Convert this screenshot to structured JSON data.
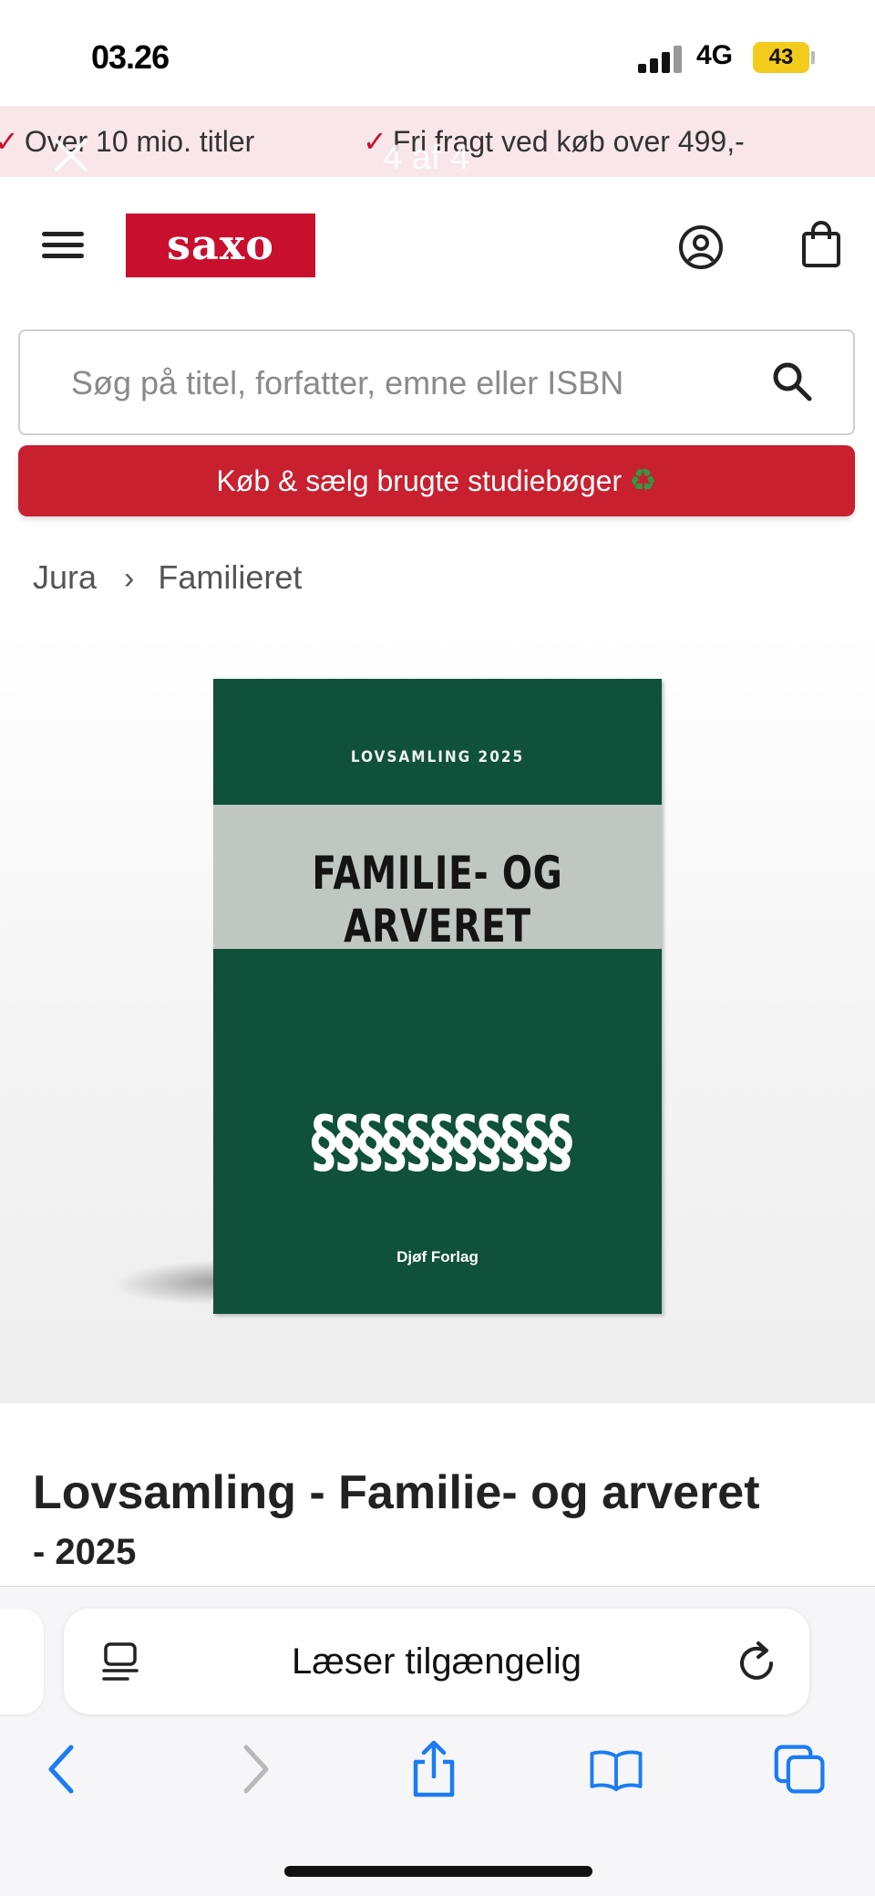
{
  "status_bar": {
    "time": "03.26",
    "network": "4G",
    "battery": "43"
  },
  "overlay": {
    "counter": "4 af 4"
  },
  "usp_bar": {
    "items": [
      "Over 10 mio. titler",
      "Fri fragt ved køb over 499,-"
    ]
  },
  "header": {
    "logo": "saxo"
  },
  "search": {
    "placeholder": "Søg på titel, forfatter, emne eller ISBN"
  },
  "cta": {
    "label": "Køb & sælg brugte studiebøger",
    "icon": "♻"
  },
  "breadcrumb": {
    "items": [
      "Jura",
      "Familieret"
    ],
    "separator": "›"
  },
  "book_cover": {
    "series": "LOVSAMLING 2025",
    "title": "FAMILIE- OG ARVERET",
    "paragraphs": "§§§§§§§§§§§",
    "publisher": "Djøf Forlag",
    "colors": {
      "cover": "#0f513b",
      "band": "#c0c7c3"
    }
  },
  "product": {
    "title": "Lovsamling - Familie- og arveret",
    "year_line": "- 2025"
  },
  "browser": {
    "address_label": "Læser tilgængelig"
  },
  "colors": {
    "brand_red": "#c8102e",
    "usp_bg": "#f8e6e8",
    "safari_blue": "#1a7cf4"
  }
}
